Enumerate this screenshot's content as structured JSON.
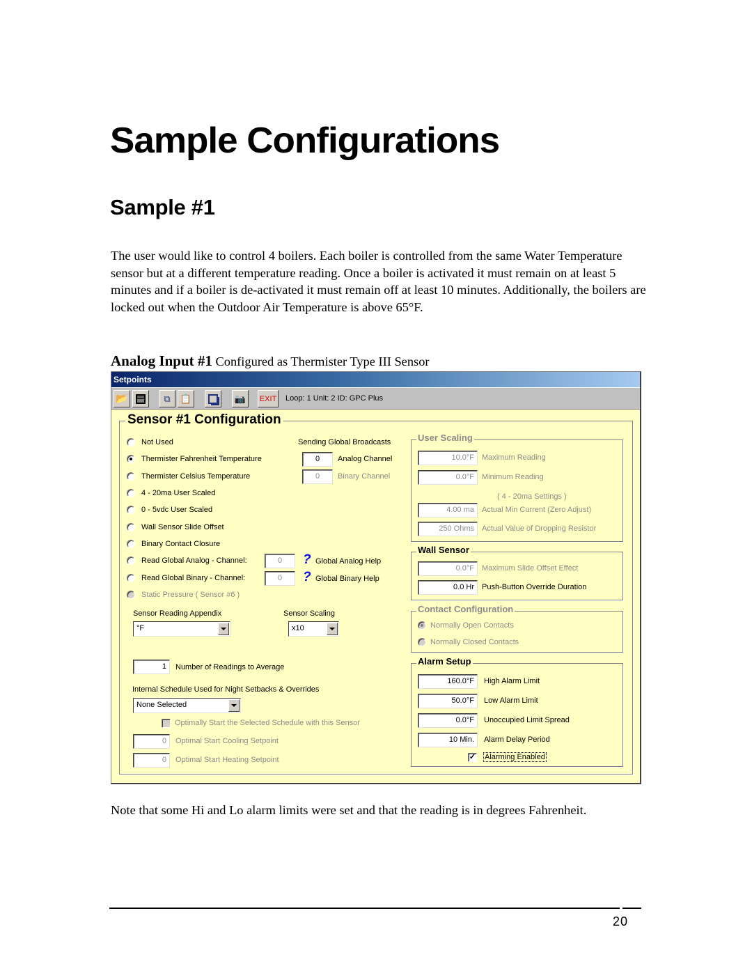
{
  "page": {
    "title": "Sample Configurations",
    "subtitle": "Sample #1",
    "paragraph": "The user would like to control 4 boilers. Each boiler is controlled from the same Water Temperature sensor but at a different temperature reading. Once a boiler is activated it must remain on at least 5 minutes and if a boiler is de-activated it must remain off at least 10 minutes. Additionally, the boilers are locked out when the Outdoor Air Temperature is above 65°F.",
    "caption_bold": "Analog Input #1",
    "caption_rest": " Configured as Thermister Type III Sensor",
    "note": "Note that some Hi and Lo alarm limits were set and that the reading is in degrees Fahrenheit.",
    "page_number": "20"
  },
  "window": {
    "title": "Setpoints",
    "toolbar": {
      "icons": [
        "open-folder-icon",
        "save-disk-icon",
        "copy-icon",
        "paste-icon",
        "select-region-icon",
        "connect-device-icon"
      ],
      "exit_label": "EXIT",
      "status": "Loop: 1  Unit: 2  ID: GPC Plus"
    },
    "frame_title": "Sensor #1 Configuration",
    "sensor_types": [
      {
        "label": "Not Used",
        "selected": false,
        "enabled": true
      },
      {
        "label": "Thermister Fahrenheit Temperature",
        "selected": true,
        "enabled": true
      },
      {
        "label": "Thermister Celsius Temperature",
        "selected": false,
        "enabled": true
      },
      {
        "label": "4 - 20ma User Scaled",
        "selected": false,
        "enabled": true
      },
      {
        "label": "0 - 5vdc User Scaled",
        "selected": false,
        "enabled": true
      },
      {
        "label": "Wall Sensor Slide Offset",
        "selected": false,
        "enabled": true
      },
      {
        "label": "Binary Contact Closure",
        "selected": false,
        "enabled": true
      },
      {
        "label": "Read Global Analog  - Channel:",
        "selected": false,
        "enabled": true
      },
      {
        "label": "Read Global Binary   - Channel:",
        "selected": false,
        "enabled": true
      },
      {
        "label": "Static Pressure ( Sensor #6 )",
        "selected": false,
        "enabled": false
      }
    ],
    "global_analog_channel": "0",
    "global_binary_channel": "0",
    "global_analog_help": "Global Analog Help",
    "global_binary_help": "Global Binary Help",
    "broadcasts": {
      "heading": "Sending Global Broadcasts",
      "analog_value": "0",
      "analog_label": "Analog Channel",
      "binary_value": "0",
      "binary_label": "Binary Channel"
    },
    "reading_appendix": {
      "label": "Sensor Reading Appendix",
      "value": "°F"
    },
    "sensor_scaling": {
      "label": "Sensor Scaling",
      "value": "x10"
    },
    "readings_average": {
      "value": "1",
      "label": "Number of Readings to Average"
    },
    "schedule": {
      "label": "Internal Schedule Used for Night Setbacks & Overrides",
      "value": "None Selected",
      "optimal_start_label": "Optimally Start the Selected Schedule with this Sensor",
      "optimal_start_checked": false,
      "cooling_value": "0",
      "cooling_label": "Optimal Start Cooling Setpoint",
      "heating_value": "0",
      "heating_label": "Optimal Start Heating Setpoint"
    },
    "user_scaling": {
      "title": "User Scaling",
      "max_value": "10.0°F",
      "max_label": "Maximum Reading",
      "min_value": "0.0°F",
      "min_label": "Minimum Reading",
      "ma_heading": "( 4 - 20ma Settings )",
      "min_current_value": "4.00 ma",
      "min_current_label": "Actual Min Current (Zero Adjust)",
      "resistor_value": "250 Ohms",
      "resistor_label": "Actual Value of Dropping Resistor"
    },
    "wall_sensor": {
      "title": "Wall Sensor",
      "slide_value": "0.0°F",
      "slide_label": "Maximum Slide Offset Effect",
      "override_value": "0.0 Hr",
      "override_label": "Push-Button Override Duration"
    },
    "contact_config": {
      "title": "Contact Configuration",
      "open_label": "Normally Open Contacts",
      "open_selected": true,
      "closed_label": "Normally Closed Contacts",
      "closed_selected": false
    },
    "alarm_setup": {
      "title": "Alarm Setup",
      "high_value": "160.0°F",
      "high_label": "High Alarm Limit",
      "low_value": "50.0°F",
      "low_label": "Low Alarm Limit",
      "spread_value": "0.0°F",
      "spread_label": "Unoccupied Limit Spread",
      "delay_value": "10 Min.",
      "delay_label": "Alarm Delay Period",
      "enabled_label": "Alarming Enabled",
      "enabled": true
    }
  }
}
